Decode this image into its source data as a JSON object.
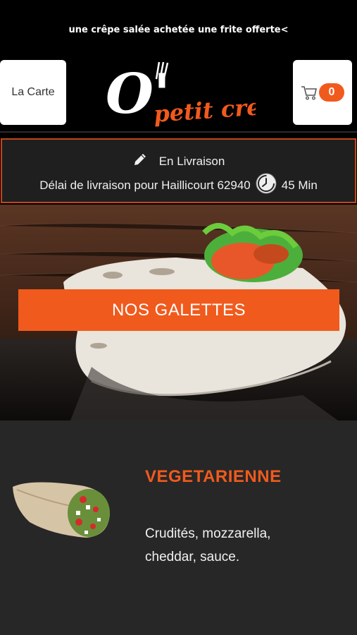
{
  "promo": {
    "text": "une crêpe salée achetée une frite offerte<"
  },
  "header": {
    "carte_label": "La Carte",
    "cart_count": "0",
    "logo_big": "O'",
    "logo_small": "petit creux"
  },
  "delivery": {
    "mode": "En Livraison",
    "delay_text": "Délai de livraison pour Haillicourt 62940",
    "time": "45 Min"
  },
  "hero": {
    "button_label": "NOS GALETTES"
  },
  "product": {
    "title": "VEGETARIENNE",
    "description": "Crudités, mozzarella, cheddar, sauce."
  },
  "colors": {
    "accent": "#f15a1d",
    "dark_bg": "#272727",
    "border": "#c2461a"
  }
}
